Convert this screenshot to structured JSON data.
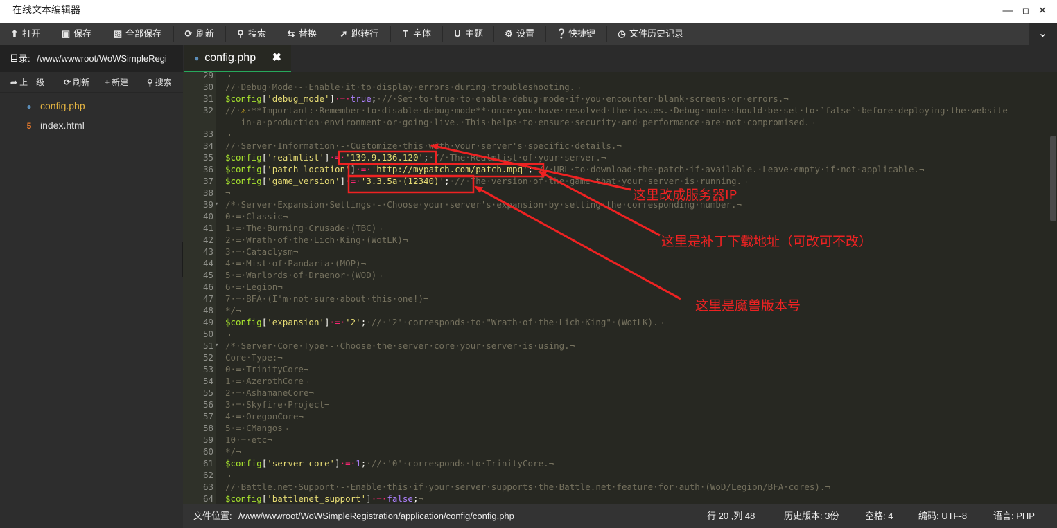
{
  "window": {
    "title": "在线文本编辑器"
  },
  "toolbar": {
    "items": [
      {
        "label": "打开",
        "icon": "upload-icon"
      },
      {
        "label": "保存",
        "icon": "floppy-icon"
      },
      {
        "label": "全部保存",
        "icon": "floppy-stack-icon"
      },
      {
        "label": "刷新",
        "icon": "refresh-icon"
      },
      {
        "label": "搜索",
        "icon": "search-icon"
      },
      {
        "label": "替换",
        "icon": "swap-icon"
      },
      {
        "label": "跳转行",
        "icon": "pin-icon"
      },
      {
        "label": "字体",
        "icon": "font-icon"
      },
      {
        "label": "主题",
        "icon": "magnet-icon"
      },
      {
        "label": "设置",
        "icon": "gear-icon"
      },
      {
        "label": "快捷键",
        "icon": "question-icon"
      },
      {
        "label": "文件历史记录",
        "icon": "clock-icon"
      }
    ]
  },
  "sidebar": {
    "dir_label": "目录:",
    "dir_path": "/www/wwwroot/WoWSimpleRegi",
    "actions": [
      "上一级",
      "刷新",
      "新建",
      "搜索"
    ],
    "files": [
      {
        "name": "config.php",
        "icon": "php-elephant-icon",
        "active": true
      },
      {
        "name": "index.html",
        "icon": "html5-icon",
        "active": false
      }
    ]
  },
  "tab": {
    "name": "config.php",
    "close": "✖"
  },
  "editor": {
    "lines": [
      {
        "n": "29",
        "t": [
          [
            "c",
            "¬"
          ]
        ]
      },
      {
        "n": "30",
        "t": [
          [
            "c",
            "//·Debug·Mode·-·Enable·it·to·display·errors·during·troubleshooting.¬"
          ]
        ]
      },
      {
        "n": "31",
        "t": [
          [
            "v",
            "$config"
          ],
          [
            "p",
            "["
          ],
          [
            "s",
            "'debug_mode'"
          ],
          [
            "p",
            "]"
          ],
          [
            "o",
            "·=·"
          ],
          [
            "k",
            "true"
          ],
          [
            "p",
            ";"
          ],
          [
            "c",
            "·//·Set·to·true·to·enable·debug·mode·if·you·encounter·blank·screens·or·errors.¬"
          ]
        ]
      },
      {
        "n": "32",
        "t": [
          [
            "c",
            "//·"
          ],
          [
            "w",
            "⚠"
          ],
          [
            "c",
            "·**Important:·Remember·to·disable·debug·mode**·once·you·have·resolved·the·issues.·Debug·mode·should·be·set·to·`false`·before·deploying·the·website"
          ]
        ]
      },
      {
        "n": "",
        "t": [
          [
            "c",
            "   in·a·production·environment·or·going·live.·This·helps·to·ensure·security·and·performance·are·not·compromised.¬"
          ]
        ]
      },
      {
        "n": "33",
        "t": [
          [
            "c",
            "¬"
          ]
        ]
      },
      {
        "n": "34",
        "t": [
          [
            "c",
            "//·Server·Information·-·Customize·this·with·your·server's·specific·details.¬"
          ]
        ]
      },
      {
        "n": "35",
        "t": [
          [
            "v",
            "$config"
          ],
          [
            "p",
            "["
          ],
          [
            "s",
            "'realmlist'"
          ],
          [
            "p",
            "]"
          ],
          [
            "o",
            "·=·"
          ],
          [
            "s",
            "'139.9.136.120'"
          ],
          [
            "p",
            ";"
          ],
          [
            "c",
            "·//·The·Realmlist·of·your·server.¬"
          ]
        ]
      },
      {
        "n": "36",
        "t": [
          [
            "v",
            "$config"
          ],
          [
            "p",
            "["
          ],
          [
            "s",
            "'patch_location'"
          ],
          [
            "p",
            "]"
          ],
          [
            "o",
            "·=·"
          ],
          [
            "s",
            "'http://mypatch.com/patch.mpq'"
          ],
          [
            "p",
            ";"
          ],
          [
            "c",
            "·//·URL·to·download·the·patch·if·available.·Leave·empty·if·not·applicable.¬"
          ]
        ]
      },
      {
        "n": "37",
        "t": [
          [
            "v",
            "$config"
          ],
          [
            "p",
            "["
          ],
          [
            "s",
            "'game_version'"
          ],
          [
            "p",
            "]"
          ],
          [
            "o",
            "·=·"
          ],
          [
            "s",
            "'3.3.5a·(12340)'"
          ],
          [
            "p",
            ";"
          ],
          [
            "c",
            "·//·The·version·of·the·game·that·your·server·is·running.¬"
          ]
        ]
      },
      {
        "n": "38",
        "t": [
          [
            "c",
            "¬"
          ]
        ]
      },
      {
        "n": "39",
        "f": true,
        "t": [
          [
            "c",
            "/*·Server·Expansion·Settings·-·Choose·your·server's·expansion·by·setting·the·corresponding·number.¬"
          ]
        ]
      },
      {
        "n": "40",
        "t": [
          [
            "c",
            "0·=·Classic¬"
          ]
        ]
      },
      {
        "n": "41",
        "t": [
          [
            "c",
            "1·=·The·Burning·Crusade·(TBC)¬"
          ]
        ]
      },
      {
        "n": "42",
        "t": [
          [
            "c",
            "2·=·Wrath·of·the·Lich·King·(WotLK)¬"
          ]
        ]
      },
      {
        "n": "43",
        "t": [
          [
            "c",
            "3·=·Cataclysm¬"
          ]
        ]
      },
      {
        "n": "44",
        "t": [
          [
            "c",
            "4·=·Mist·of·Pandaria·(MOP)¬"
          ]
        ]
      },
      {
        "n": "45",
        "t": [
          [
            "c",
            "5·=·Warlords·of·Draenor·(WOD)¬"
          ]
        ]
      },
      {
        "n": "46",
        "t": [
          [
            "c",
            "6·=·Legion¬"
          ]
        ]
      },
      {
        "n": "47",
        "t": [
          [
            "c",
            "7·=·BFA·(I'm·not·sure·about·this·one!)¬"
          ]
        ]
      },
      {
        "n": "48",
        "t": [
          [
            "c",
            "*/¬"
          ]
        ]
      },
      {
        "n": "49",
        "t": [
          [
            "v",
            "$config"
          ],
          [
            "p",
            "["
          ],
          [
            "s",
            "'expansion'"
          ],
          [
            "p",
            "]"
          ],
          [
            "o",
            "·=·"
          ],
          [
            "s",
            "'2'"
          ],
          [
            "p",
            ";"
          ],
          [
            "c",
            "·//·'2'·corresponds·to·\"Wrath·of·the·Lich·King\"·(WotLK).¬"
          ]
        ]
      },
      {
        "n": "50",
        "t": [
          [
            "c",
            "¬"
          ]
        ]
      },
      {
        "n": "51",
        "f": true,
        "t": [
          [
            "c",
            "/*·Server·Core·Type·-·Choose·the·server·core·your·server·is·using.¬"
          ]
        ]
      },
      {
        "n": "52",
        "t": [
          [
            "c",
            "Core·Type:¬"
          ]
        ]
      },
      {
        "n": "53",
        "t": [
          [
            "c",
            "0·=·TrinityCore¬"
          ]
        ]
      },
      {
        "n": "54",
        "t": [
          [
            "c",
            "1·=·AzerothCore¬"
          ]
        ]
      },
      {
        "n": "55",
        "t": [
          [
            "c",
            "2·=·AshamaneCore¬"
          ]
        ]
      },
      {
        "n": "56",
        "t": [
          [
            "c",
            "3·=·Skyfire·Project¬"
          ]
        ]
      },
      {
        "n": "57",
        "t": [
          [
            "c",
            "4·=·OregonCore¬"
          ]
        ]
      },
      {
        "n": "58",
        "t": [
          [
            "c",
            "5·=·CMangos¬"
          ]
        ]
      },
      {
        "n": "59",
        "t": [
          [
            "c",
            "10·=·etc¬"
          ]
        ]
      },
      {
        "n": "60",
        "t": [
          [
            "c",
            "*/¬"
          ]
        ]
      },
      {
        "n": "61",
        "t": [
          [
            "v",
            "$config"
          ],
          [
            "p",
            "["
          ],
          [
            "s",
            "'server_core'"
          ],
          [
            "p",
            "]"
          ],
          [
            "o",
            "·=·"
          ],
          [
            "k",
            "1"
          ],
          [
            "p",
            ";"
          ],
          [
            "c",
            "·//·'0'·corresponds·to·TrinityCore.¬"
          ]
        ]
      },
      {
        "n": "62",
        "t": [
          [
            "c",
            "¬"
          ]
        ]
      },
      {
        "n": "63",
        "t": [
          [
            "c",
            "//·Battle.net·Support·-·Enable·this·if·your·server·supports·the·Battle.net·feature·for·auth·(WoD/Legion/BFA·cores).¬"
          ]
        ]
      },
      {
        "n": "64",
        "t": [
          [
            "v",
            "$config"
          ],
          [
            "p",
            "["
          ],
          [
            "s",
            "'battlenet_support'"
          ],
          [
            "p",
            "]"
          ],
          [
            "o",
            "·=·"
          ],
          [
            "k",
            "false"
          ],
          [
            "p",
            ";"
          ],
          [
            "c",
            "¬"
          ]
        ]
      }
    ]
  },
  "status": {
    "path_label": "文件位置:",
    "path": "/www/wwwroot/WoWSimpleRegistration/application/config/config.php",
    "cursor": "行 20 ,列 48",
    "history": "历史版本: 3份",
    "indent": "空格: 4",
    "encoding": "编码: UTF-8",
    "language": "语言: PHP"
  },
  "annotations": {
    "server_ip": "这里改成服务器IP",
    "patch_url": "这里是补丁下载地址（可改可不改）",
    "game_version": "这里是魔兽版本号"
  },
  "colors": {
    "annotation": "#ee2222",
    "tab_underline": "#27a85c",
    "active_file": "#e3b341"
  }
}
